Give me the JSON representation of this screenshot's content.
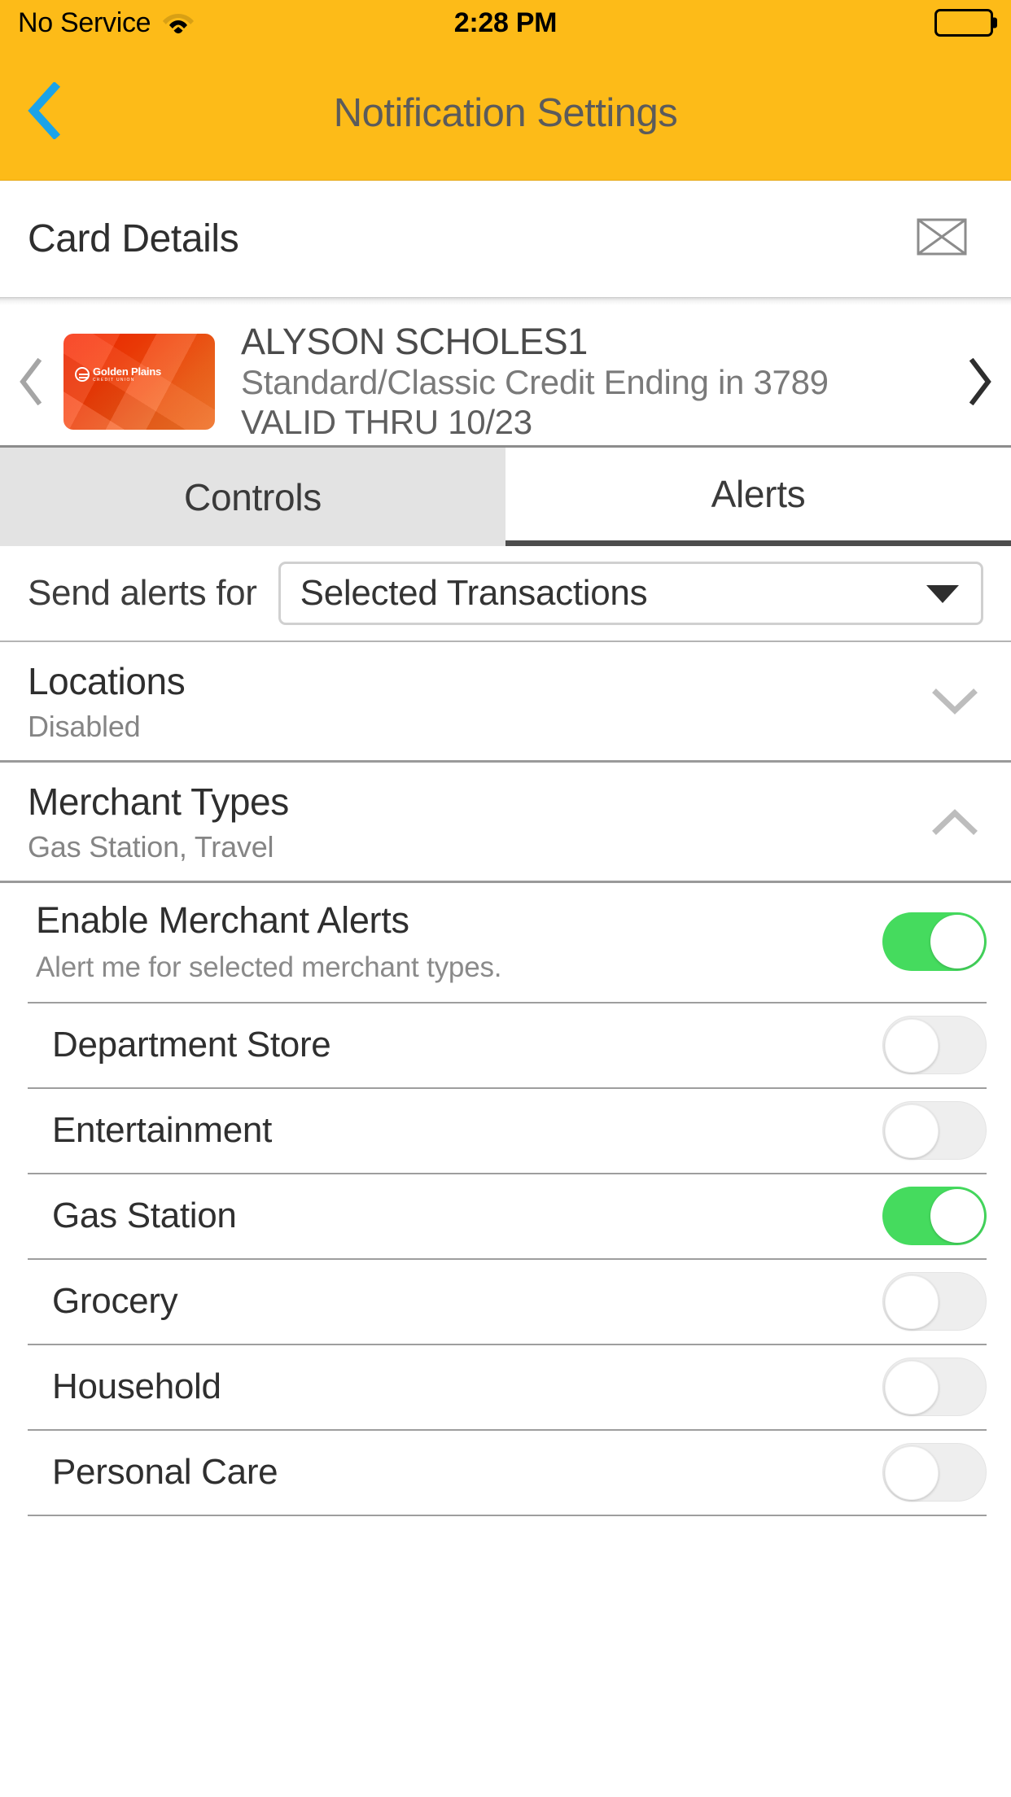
{
  "status_bar": {
    "carrier": "No Service",
    "time": "2:28 PM",
    "wifi_icon": "wifi-icon",
    "battery_icon": "battery-full-icon"
  },
  "nav": {
    "title": "Notification Settings",
    "back_icon": "chevron-left-icon",
    "back_color": "#1BA3E8",
    "bar_color": "#FDBB18"
  },
  "card_details": {
    "title": "Card Details",
    "mail_icon": "envelope-icon"
  },
  "card": {
    "prev_icon": "chevron-left-icon",
    "next_icon": "chevron-right-icon",
    "logo_name": "Golden Plains",
    "logo_sub": "CREDIT UNION",
    "holder_name": "ALYSON SCHOLES1",
    "description": "Standard/Classic Credit Ending in 3789",
    "valid_thru": "VALID THRU 10/23"
  },
  "tabs": [
    {
      "label": "Controls",
      "active": false
    },
    {
      "label": "Alerts",
      "active": true
    }
  ],
  "send_alerts": {
    "label": "Send alerts for",
    "selected": "Selected Transactions",
    "caret_icon": "caret-down-icon"
  },
  "sections": [
    {
      "title": "Locations",
      "subtitle": "Disabled",
      "expanded": false,
      "chevron_icon": "chevron-down-icon"
    },
    {
      "title": "Merchant Types",
      "subtitle": "Gas Station, Travel",
      "expanded": true,
      "chevron_icon": "chevron-up-icon"
    }
  ],
  "enable_merchant": {
    "title": "Enable Merchant Alerts",
    "subtitle": "Alert me for selected merchant types.",
    "enabled": true
  },
  "merchant_types": [
    {
      "label": "Department Store",
      "enabled": false
    },
    {
      "label": "Entertainment",
      "enabled": false
    },
    {
      "label": "Gas Station",
      "enabled": true
    },
    {
      "label": "Grocery",
      "enabled": false
    },
    {
      "label": "Household",
      "enabled": false
    },
    {
      "label": "Personal Care",
      "enabled": false
    }
  ],
  "colors": {
    "accent": "#FDBB18",
    "toggle_on": "#45DB5E",
    "toggle_off": "#EEEEEE",
    "back_blue": "#1BA3E8"
  }
}
